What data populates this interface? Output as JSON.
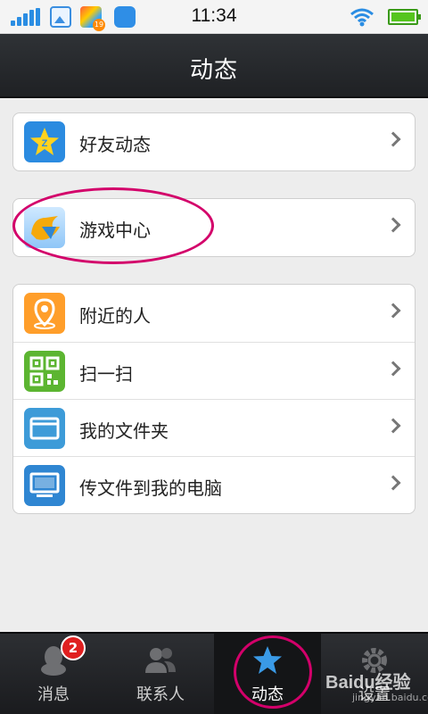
{
  "status_bar": {
    "time": "11:34",
    "app_badge": "19"
  },
  "header": {
    "title": "动态"
  },
  "groups": [
    {
      "items": [
        {
          "label": "好友动态",
          "icon": "qzone-star-icon"
        }
      ]
    },
    {
      "items": [
        {
          "label": "游戏中心",
          "icon": "game-center-icon"
        }
      ]
    },
    {
      "items": [
        {
          "label": "附近的人",
          "icon": "location-pin-icon"
        },
        {
          "label": "扫一扫",
          "icon": "qr-code-icon"
        },
        {
          "label": "我的文件夹",
          "icon": "folder-icon"
        },
        {
          "label": "传文件到我的电脑",
          "icon": "monitor-icon"
        }
      ]
    }
  ],
  "bottom_nav": {
    "tabs": [
      {
        "label": "消息",
        "badge": "2"
      },
      {
        "label": "联系人"
      },
      {
        "label": "动态"
      },
      {
        "label": "设置"
      }
    ]
  },
  "watermark": {
    "brand": "Baidu经验",
    "url": "jingyan.baidu.com"
  },
  "colors": {
    "header_bg": "#26282b",
    "annotation": "#d3006a",
    "accent": "#2b8be0"
  }
}
